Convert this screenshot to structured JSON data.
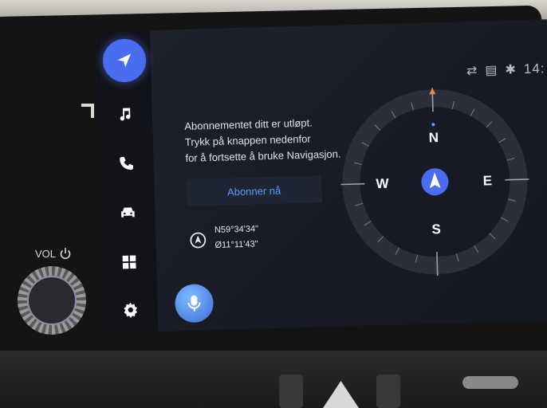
{
  "status_bar": {
    "time": "14:"
  },
  "message": {
    "line1": "Abonnementet ditt er utløpt.",
    "line2": "Trykk på knappen nedenfor",
    "line3": "for å fortsette å bruke Navigasjon."
  },
  "subscribe_button": "Abonner nå",
  "coordinates": {
    "lat": "N59°34'34\"",
    "lon": "Ø11°11'43\""
  },
  "compass": {
    "n": "N",
    "e": "E",
    "s": "S",
    "w": "W"
  },
  "sidebar": {
    "items": [
      {
        "icon": "navigation-icon",
        "active": true
      },
      {
        "icon": "music-icon"
      },
      {
        "icon": "phone-icon"
      },
      {
        "icon": "car-icon"
      },
      {
        "icon": "apps-icon"
      },
      {
        "icon": "gear-icon"
      }
    ]
  },
  "hardware": {
    "vol_label": "VOL"
  },
  "colors": {
    "accent": "#4a6cf0",
    "link": "#5a9cff",
    "compass_marker": "#e08a4a"
  }
}
